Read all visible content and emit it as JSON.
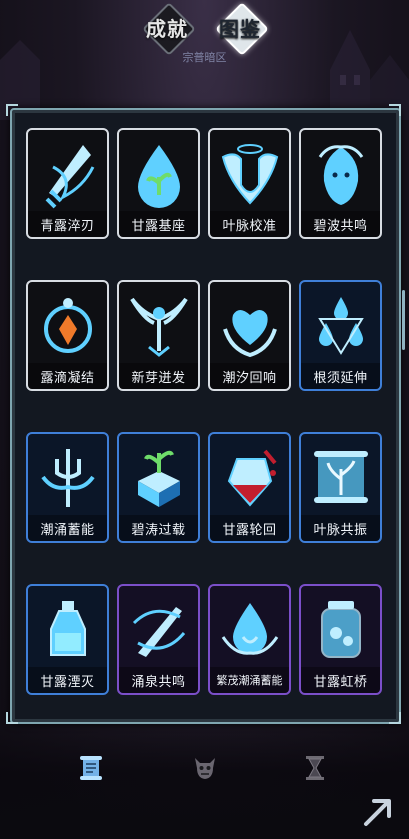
{
  "tabs": {
    "achievement": "成就",
    "codex": "图鉴",
    "active": "codex"
  },
  "subtitle": "宗普暗区",
  "colors": {
    "frame": "#7fa6b0",
    "tier_white": "#d8dde3",
    "tier_blue": "#3f7fd8",
    "tier_purple": "#7b4fc9",
    "icon_glow": "#5fd0ff"
  },
  "cards": [
    {
      "name": "青露淬刃",
      "tier": "white",
      "icon": "dagger-icon"
    },
    {
      "name": "甘露基座",
      "tier": "white",
      "icon": "sprout-drop-icon"
    },
    {
      "name": "叶脉校准",
      "tier": "white",
      "icon": "winged-shield-icon"
    },
    {
      "name": "碧波共鸣",
      "tier": "white",
      "icon": "water-spirit-icon"
    },
    {
      "name": "露滴凝结",
      "tier": "white",
      "icon": "crystal-amulet-icon"
    },
    {
      "name": "新芽迸发",
      "tier": "white",
      "icon": "phoenix-icon"
    },
    {
      "name": "潮汐回响",
      "tier": "white",
      "icon": "heart-hands-icon"
    },
    {
      "name": "根须延伸",
      "tier": "blue",
      "icon": "triple-drop-icon"
    },
    {
      "name": "潮涌蓄能",
      "tier": "blue",
      "icon": "trident-emblem-icon"
    },
    {
      "name": "碧涛过载",
      "tier": "blue",
      "icon": "sprout-cube-icon"
    },
    {
      "name": "甘露轮回",
      "tier": "blue",
      "icon": "blood-potion-icon"
    },
    {
      "name": "叶脉共振",
      "tier": "blue",
      "icon": "scroll-tree-icon"
    },
    {
      "name": "甘露湮灭",
      "tier": "blue",
      "icon": "potion-bottle-icon"
    },
    {
      "name": "涌泉共鸣",
      "tier": "purple",
      "icon": "sword-swirl-icon"
    },
    {
      "name": "繁茂潮涌蓄能",
      "tier": "purple",
      "icon": "drop-emblem-icon"
    },
    {
      "name": "甘露虹桥",
      "tier": "purple",
      "icon": "jar-icon"
    },
    {
      "name": "",
      "tier": "purple",
      "icon": "vortex-icon"
    },
    {
      "name": "",
      "tier": "purple",
      "icon": "flame-drop-icon"
    },
    {
      "name": "",
      "tier": "purple",
      "icon": "fountain-icon"
    },
    {
      "name": "",
      "tier": "purple",
      "icon": "frost-crown-icon"
    }
  ],
  "bottom_nav": [
    {
      "icon": "scroll-icon",
      "active": true
    },
    {
      "icon": "demon-mask-icon",
      "active": false
    },
    {
      "icon": "hourglass-icon",
      "active": false
    }
  ]
}
